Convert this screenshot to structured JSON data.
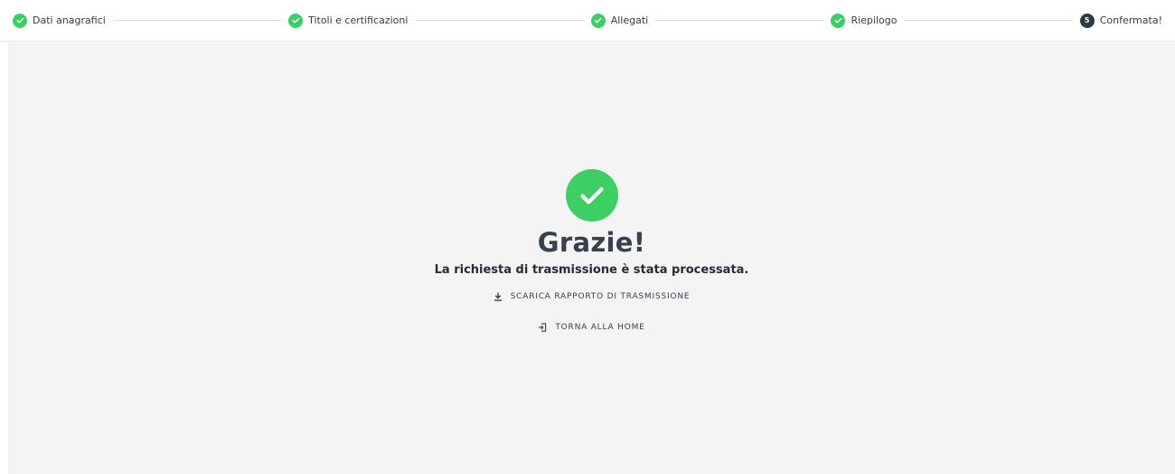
{
  "stepper": {
    "steps": [
      {
        "label": "Dati anagrafici",
        "state": "done"
      },
      {
        "label": "Titoli e certificazioni",
        "state": "done"
      },
      {
        "label": "Allegati",
        "state": "done"
      },
      {
        "label": "Riepilogo",
        "state": "done"
      },
      {
        "label": "Confermata!",
        "state": "current",
        "number": "5"
      }
    ]
  },
  "confirmation": {
    "title": "Grazie!",
    "message": "La richiesta di trasmissione è stata processata.",
    "download_label": "SCARICA RAPPORTO DI TRASMISSIONE",
    "home_label": "TORNA ALLA HOME"
  },
  "colors": {
    "success": "#3ecf64",
    "current_step": "#2f3742",
    "background": "#f4f4f4",
    "text": "#37404c"
  }
}
